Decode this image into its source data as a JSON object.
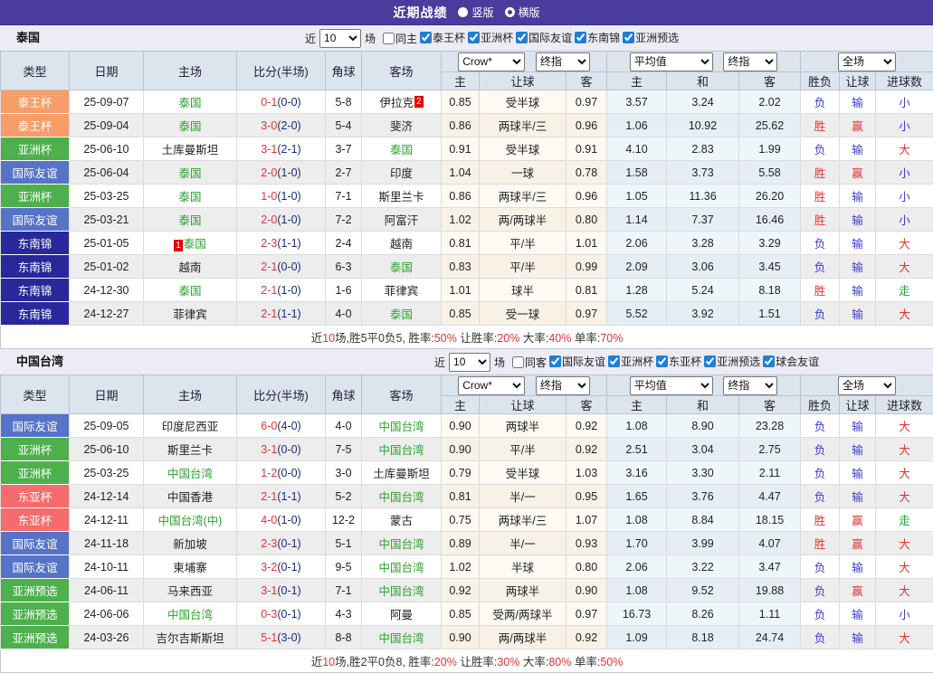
{
  "banner": {
    "title": "近期战绩",
    "vertical_label": "竖版",
    "horizontal_label": "横版",
    "vertical_selected": true,
    "horizontal_selected": false
  },
  "colors": {
    "banner_bg": "#4a3c9c",
    "section_bar_bg": "#ececf5",
    "header_cell_bg": "#dce4ee",
    "score_ft": "#e53333",
    "score_ht": "#1b2a78",
    "team_highlight": "#2aa12a",
    "badge_bg": "#e60000"
  },
  "type_colors": {
    "泰王杯": "#f79e68",
    "亚洲杯": "#4db04d",
    "国际友谊": "#5673c8",
    "东南锦": "#28289b",
    "东亚杯": "#f66c6c",
    "亚洲预选": "#4db04d"
  },
  "result_colors": {
    "win": "#e53333",
    "lose": "#3b3bd0",
    "draw": "#1e9e3c"
  },
  "columns": {
    "type": "类型",
    "date": "日期",
    "home": "主场",
    "score": "比分(半场)",
    "corner": "角球",
    "away": "客场",
    "sub": [
      "主",
      "让球",
      "客",
      "主",
      "和",
      "客",
      "胜负",
      "让球",
      "进球数"
    ],
    "selects": {
      "provider": "Crow*",
      "final": "终指",
      "average": "平均值",
      "final2": "终指",
      "scope": "全场"
    }
  },
  "sections": [
    {
      "team": "泰国",
      "filters": {
        "near": "近",
        "count": "10",
        "games": "场",
        "same": "同主",
        "same_checked": false,
        "leagues": [
          {
            "label": "泰王杯",
            "checked": true
          },
          {
            "label": "亚洲杯",
            "checked": true
          },
          {
            "label": "国际友谊",
            "checked": true
          },
          {
            "label": "东南锦",
            "checked": true
          },
          {
            "label": "亚洲预选",
            "checked": true
          }
        ]
      },
      "rows": [
        {
          "type": "泰王杯",
          "date": "25-09-07",
          "home": "泰国",
          "home_hl": true,
          "home_badge": "",
          "ft": "0-1",
          "ht": "(0-0)",
          "corner": "5-8",
          "away": "伊拉克",
          "away_hl": false,
          "away_badge": "2",
          "crow": [
            "0.85",
            "受半球",
            "0.97"
          ],
          "avg": [
            "3.57",
            "3.24",
            "2.02"
          ],
          "results": [
            [
              "负",
              "lose"
            ],
            [
              "输",
              "lose"
            ],
            [
              "小",
              "lose"
            ]
          ]
        },
        {
          "type": "泰王杯",
          "date": "25-09-04",
          "home": "泰国",
          "home_hl": true,
          "home_badge": "",
          "ft": "3-0",
          "ht": "(2-0)",
          "corner": "5-4",
          "away": "斐济",
          "away_hl": false,
          "away_badge": "",
          "crow": [
            "0.86",
            "两球半/三",
            "0.96"
          ],
          "avg": [
            "1.06",
            "10.92",
            "25.62"
          ],
          "results": [
            [
              "胜",
              "win"
            ],
            [
              "赢",
              "win"
            ],
            [
              "小",
              "lose"
            ]
          ]
        },
        {
          "type": "亚洲杯",
          "date": "25-06-10",
          "home": "土库曼斯坦",
          "home_hl": false,
          "home_badge": "",
          "ft": "3-1",
          "ht": "(2-1)",
          "corner": "3-7",
          "away": "泰国",
          "away_hl": true,
          "away_badge": "",
          "crow": [
            "0.91",
            "受半球",
            "0.91"
          ],
          "avg": [
            "4.10",
            "2.83",
            "1.99"
          ],
          "results": [
            [
              "负",
              "lose"
            ],
            [
              "输",
              "lose"
            ],
            [
              "大",
              "win"
            ]
          ]
        },
        {
          "type": "国际友谊",
          "date": "25-06-04",
          "home": "泰国",
          "home_hl": true,
          "home_badge": "",
          "ft": "2-0",
          "ht": "(1-0)",
          "corner": "2-7",
          "away": "印度",
          "away_hl": false,
          "away_badge": "",
          "crow": [
            "1.04",
            "一球",
            "0.78"
          ],
          "avg": [
            "1.58",
            "3.73",
            "5.58"
          ],
          "results": [
            [
              "胜",
              "win"
            ],
            [
              "赢",
              "win"
            ],
            [
              "小",
              "lose"
            ]
          ]
        },
        {
          "type": "亚洲杯",
          "date": "25-03-25",
          "home": "泰国",
          "home_hl": true,
          "home_badge": "",
          "ft": "1-0",
          "ht": "(1-0)",
          "corner": "7-1",
          "away": "斯里兰卡",
          "away_hl": false,
          "away_badge": "",
          "crow": [
            "0.86",
            "两球半/三",
            "0.96"
          ],
          "avg": [
            "1.05",
            "11.36",
            "26.20"
          ],
          "results": [
            [
              "胜",
              "win"
            ],
            [
              "输",
              "lose"
            ],
            [
              "小",
              "lose"
            ]
          ]
        },
        {
          "type": "国际友谊",
          "date": "25-03-21",
          "home": "泰国",
          "home_hl": true,
          "home_badge": "",
          "ft": "2-0",
          "ht": "(1-0)",
          "corner": "7-2",
          "away": "阿富汗",
          "away_hl": false,
          "away_badge": "",
          "crow": [
            "1.02",
            "两/两球半",
            "0.80"
          ],
          "avg": [
            "1.14",
            "7.37",
            "16.46"
          ],
          "results": [
            [
              "胜",
              "win"
            ],
            [
              "输",
              "lose"
            ],
            [
              "小",
              "lose"
            ]
          ]
        },
        {
          "type": "东南锦",
          "date": "25-01-05",
          "home": "泰国",
          "home_hl": true,
          "home_badge": "1",
          "ft": "2-3",
          "ht": "(1-1)",
          "corner": "2-4",
          "away": "越南",
          "away_hl": false,
          "away_badge": "",
          "crow": [
            "0.81",
            "平/半",
            "1.01"
          ],
          "avg": [
            "2.06",
            "3.28",
            "3.29"
          ],
          "results": [
            [
              "负",
              "lose"
            ],
            [
              "输",
              "lose"
            ],
            [
              "大",
              "win"
            ]
          ]
        },
        {
          "type": "东南锦",
          "date": "25-01-02",
          "home": "越南",
          "home_hl": false,
          "home_badge": "",
          "ft": "2-1",
          "ht": "(0-0)",
          "corner": "6-3",
          "away": "泰国",
          "away_hl": true,
          "away_badge": "",
          "crow": [
            "0.83",
            "平/半",
            "0.99"
          ],
          "avg": [
            "2.09",
            "3.06",
            "3.45"
          ],
          "results": [
            [
              "负",
              "lose"
            ],
            [
              "输",
              "lose"
            ],
            [
              "大",
              "win"
            ]
          ]
        },
        {
          "type": "东南锦",
          "date": "24-12-30",
          "home": "泰国",
          "home_hl": true,
          "home_badge": "",
          "ft": "2-1",
          "ht": "(1-0)",
          "corner": "1-6",
          "away": "菲律宾",
          "away_hl": false,
          "away_badge": "",
          "crow": [
            "1.01",
            "球半",
            "0.81"
          ],
          "avg": [
            "1.28",
            "5.24",
            "8.18"
          ],
          "results": [
            [
              "胜",
              "win"
            ],
            [
              "输",
              "lose"
            ],
            [
              "走",
              "draw"
            ]
          ]
        },
        {
          "type": "东南锦",
          "date": "24-12-27",
          "home": "菲律宾",
          "home_hl": false,
          "home_badge": "",
          "ft": "2-1",
          "ht": "(1-1)",
          "corner": "4-0",
          "away": "泰国",
          "away_hl": true,
          "away_badge": "",
          "crow": [
            "0.85",
            "受一球",
            "0.97"
          ],
          "avg": [
            "5.52",
            "3.92",
            "1.51"
          ],
          "results": [
            [
              "负",
              "lose"
            ],
            [
              "输",
              "lose"
            ],
            [
              "大",
              "win"
            ]
          ]
        }
      ],
      "summary": [
        [
          "近",
          "t"
        ],
        [
          "10",
          "n"
        ],
        [
          "场,胜5平0负5, 胜率:",
          "t"
        ],
        [
          "50%",
          "n"
        ],
        [
          " 让胜率:",
          "t"
        ],
        [
          "20%",
          "n"
        ],
        [
          " 大率:",
          "t"
        ],
        [
          "40%",
          "n"
        ],
        [
          " 单率:",
          "t"
        ],
        [
          "70%",
          "n"
        ]
      ]
    },
    {
      "team": "中国台湾",
      "filters": {
        "near": "近",
        "count": "10",
        "games": "场",
        "same": "同客",
        "same_checked": false,
        "leagues": [
          {
            "label": "国际友谊",
            "checked": true
          },
          {
            "label": "亚洲杯",
            "checked": true
          },
          {
            "label": "东亚杯",
            "checked": true
          },
          {
            "label": "亚洲预选",
            "checked": true
          },
          {
            "label": "球会友谊",
            "checked": true
          }
        ]
      },
      "rows": [
        {
          "type": "国际友谊",
          "date": "25-09-05",
          "home": "印度尼西亚",
          "home_hl": false,
          "home_badge": "",
          "ft": "6-0",
          "ht": "(4-0)",
          "corner": "4-0",
          "away": "中国台湾",
          "away_hl": true,
          "away_badge": "",
          "crow": [
            "0.90",
            "两球半",
            "0.92"
          ],
          "avg": [
            "1.08",
            "8.90",
            "23.28"
          ],
          "results": [
            [
              "负",
              "lose"
            ],
            [
              "输",
              "lose"
            ],
            [
              "大",
              "win"
            ]
          ]
        },
        {
          "type": "亚洲杯",
          "date": "25-06-10",
          "home": "斯里兰卡",
          "home_hl": false,
          "home_badge": "",
          "ft": "3-1",
          "ht": "(0-0)",
          "corner": "7-5",
          "away": "中国台湾",
          "away_hl": true,
          "away_badge": "",
          "crow": [
            "0.90",
            "平/半",
            "0.92"
          ],
          "avg": [
            "2.51",
            "3.04",
            "2.75"
          ],
          "results": [
            [
              "负",
              "lose"
            ],
            [
              "输",
              "lose"
            ],
            [
              "大",
              "win"
            ]
          ]
        },
        {
          "type": "亚洲杯",
          "date": "25-03-25",
          "home": "中国台湾",
          "home_hl": true,
          "home_badge": "",
          "ft": "1-2",
          "ht": "(0-0)",
          "corner": "3-0",
          "away": "土库曼斯坦",
          "away_hl": false,
          "away_badge": "",
          "crow": [
            "0.79",
            "受半球",
            "1.03"
          ],
          "avg": [
            "3.16",
            "3.30",
            "2.11"
          ],
          "results": [
            [
              "负",
              "lose"
            ],
            [
              "输",
              "lose"
            ],
            [
              "大",
              "win"
            ]
          ]
        },
        {
          "type": "东亚杯",
          "date": "24-12-14",
          "home": "中国香港",
          "home_hl": false,
          "home_badge": "",
          "ft": "2-1",
          "ht": "(1-1)",
          "corner": "5-2",
          "away": "中国台湾",
          "away_hl": true,
          "away_badge": "",
          "crow": [
            "0.81",
            "半/一",
            "0.95"
          ],
          "avg": [
            "1.65",
            "3.76",
            "4.47"
          ],
          "results": [
            [
              "负",
              "lose"
            ],
            [
              "输",
              "lose"
            ],
            [
              "大",
              "win"
            ]
          ]
        },
        {
          "type": "东亚杯",
          "date": "24-12-11",
          "home": "中国台湾(中)",
          "home_hl": true,
          "home_badge": "",
          "ft": "4-0",
          "ht": "(1-0)",
          "corner": "12-2",
          "away": "蒙古",
          "away_hl": false,
          "away_badge": "",
          "crow": [
            "0.75",
            "两球半/三",
            "1.07"
          ],
          "avg": [
            "1.08",
            "8.84",
            "18.15"
          ],
          "results": [
            [
              "胜",
              "win"
            ],
            [
              "赢",
              "win"
            ],
            [
              "走",
              "draw"
            ]
          ]
        },
        {
          "type": "国际友谊",
          "date": "24-11-18",
          "home": "新加坡",
          "home_hl": false,
          "home_badge": "",
          "ft": "2-3",
          "ht": "(0-1)",
          "corner": "5-1",
          "away": "中国台湾",
          "away_hl": true,
          "away_badge": "",
          "crow": [
            "0.89",
            "半/一",
            "0.93"
          ],
          "avg": [
            "1.70",
            "3.99",
            "4.07"
          ],
          "results": [
            [
              "胜",
              "win"
            ],
            [
              "赢",
              "win"
            ],
            [
              "大",
              "win"
            ]
          ]
        },
        {
          "type": "国际友谊",
          "date": "24-10-11",
          "home": "柬埔寨",
          "home_hl": false,
          "home_badge": "",
          "ft": "3-2",
          "ht": "(0-1)",
          "corner": "9-5",
          "away": "中国台湾",
          "away_hl": true,
          "away_badge": "",
          "crow": [
            "1.02",
            "半球",
            "0.80"
          ],
          "avg": [
            "2.06",
            "3.22",
            "3.47"
          ],
          "results": [
            [
              "负",
              "lose"
            ],
            [
              "输",
              "lose"
            ],
            [
              "大",
              "win"
            ]
          ]
        },
        {
          "type": "亚洲预选",
          "date": "24-06-11",
          "home": "马来西亚",
          "home_hl": false,
          "home_badge": "",
          "ft": "3-1",
          "ht": "(0-1)",
          "corner": "7-1",
          "away": "中国台湾",
          "away_hl": true,
          "away_badge": "",
          "crow": [
            "0.92",
            "两球半",
            "0.90"
          ],
          "avg": [
            "1.08",
            "9.52",
            "19.88"
          ],
          "results": [
            [
              "负",
              "lose"
            ],
            [
              "赢",
              "win"
            ],
            [
              "大",
              "win"
            ]
          ]
        },
        {
          "type": "亚洲预选",
          "date": "24-06-06",
          "home": "中国台湾",
          "home_hl": true,
          "home_badge": "",
          "ft": "0-3",
          "ht": "(0-1)",
          "corner": "4-3",
          "away": "阿曼",
          "away_hl": false,
          "away_badge": "",
          "crow": [
            "0.85",
            "受两/两球半",
            "0.97"
          ],
          "avg": [
            "16.73",
            "8.26",
            "1.11"
          ],
          "results": [
            [
              "负",
              "lose"
            ],
            [
              "输",
              "lose"
            ],
            [
              "小",
              "lose"
            ]
          ]
        },
        {
          "type": "亚洲预选",
          "date": "24-03-26",
          "home": "吉尔吉斯斯坦",
          "home_hl": false,
          "home_badge": "",
          "ft": "5-1",
          "ht": "(3-0)",
          "corner": "8-8",
          "away": "中国台湾",
          "away_hl": true,
          "away_badge": "",
          "crow": [
            "0.90",
            "两/两球半",
            "0.92"
          ],
          "avg": [
            "1.09",
            "8.18",
            "24.74"
          ],
          "results": [
            [
              "负",
              "lose"
            ],
            [
              "输",
              "lose"
            ],
            [
              "大",
              "win"
            ]
          ]
        }
      ],
      "summary": [
        [
          "近",
          "t"
        ],
        [
          "10",
          "n"
        ],
        [
          "场,胜2平0负8, 胜率:",
          "t"
        ],
        [
          "20%",
          "n"
        ],
        [
          " 让胜率:",
          "t"
        ],
        [
          "30%",
          "n"
        ],
        [
          " 大率:",
          "t"
        ],
        [
          "80%",
          "n"
        ],
        [
          " 单率:",
          "t"
        ],
        [
          "50%",
          "n"
        ]
      ]
    }
  ]
}
